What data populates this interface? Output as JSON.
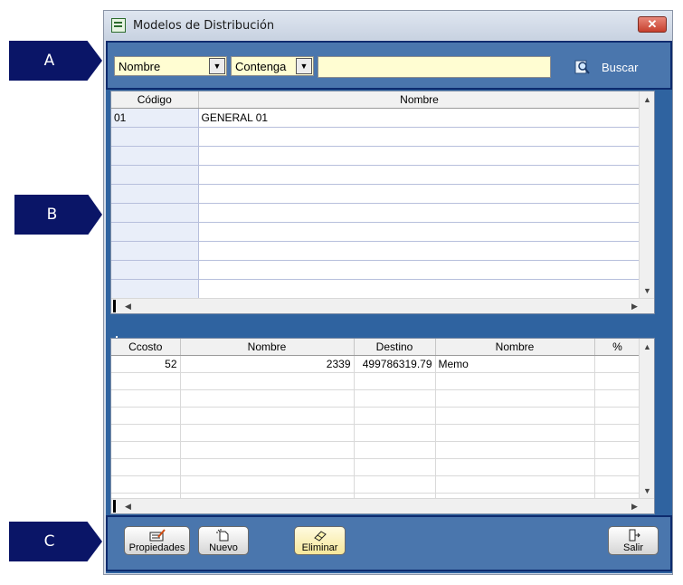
{
  "callouts": [
    "A",
    "B",
    "C"
  ],
  "window": {
    "title": "Modelos de Distribución",
    "close_glyph": "✕"
  },
  "search": {
    "field_select": "Nombre",
    "operator_select": "Contenga",
    "value": "",
    "buscar_label": "Buscar"
  },
  "grid1": {
    "columns": [
      "Código",
      "Nombre"
    ],
    "rows": [
      {
        "codigo": "01",
        "nombre": "GENERAL 01"
      }
    ]
  },
  "grid2": {
    "columns": [
      "Ccosto",
      "Nombre",
      "Destino",
      "Nombre",
      "%"
    ],
    "rows": [
      {
        "ccosto": "52",
        "nombre": "2339",
        "destino": "499786319.79",
        "nombre2": "Memo",
        "pct": ""
      }
    ]
  },
  "toolbar": {
    "propiedades": "Propiedades",
    "nuevo": "Nuevo",
    "eliminar": "Eliminar",
    "salir": "Salir"
  },
  "colors": {
    "callout": "#0a1567",
    "panel": "#4a76ad",
    "panel_border": "#0d2b6e",
    "field_bg": "#fffdd2"
  },
  "icons": [
    "app-icon",
    "close-icon",
    "magnifier-icon",
    "properties-icon",
    "new-document-icon",
    "eraser-icon",
    "exit-icon"
  ]
}
